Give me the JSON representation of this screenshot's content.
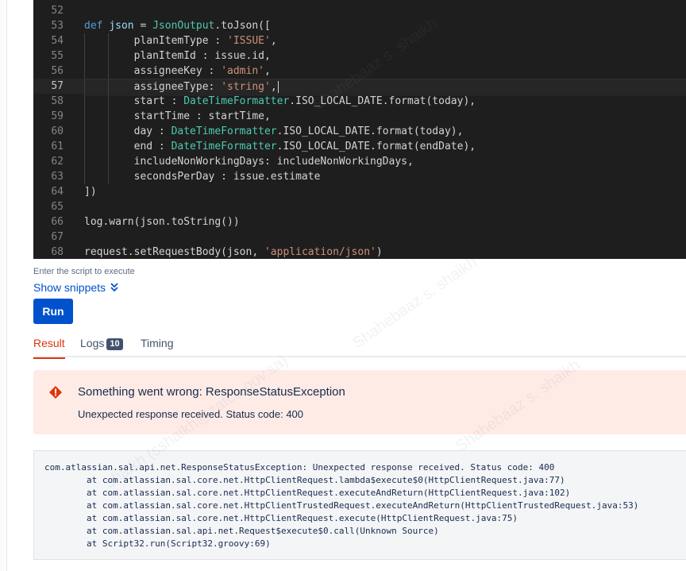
{
  "editor": {
    "lines": [
      {
        "num": "52",
        "tokens": []
      },
      {
        "num": "53",
        "tokens": [
          {
            "t": "def ",
            "c": "kw"
          },
          {
            "t": "json",
            "c": "var"
          },
          {
            "t": " = ",
            "c": "plain"
          },
          {
            "t": "JsonOutput",
            "c": "cls"
          },
          {
            "t": ".toJson([",
            "c": "plain"
          }
        ]
      },
      {
        "num": "54",
        "tokens": [
          {
            "t": "        planItemType : ",
            "c": "plain"
          },
          {
            "t": "'ISSUE'",
            "c": "str"
          },
          {
            "t": ",",
            "c": "plain"
          }
        ]
      },
      {
        "num": "55",
        "tokens": [
          {
            "t": "        planItemId : issue.id,",
            "c": "plain"
          }
        ]
      },
      {
        "num": "56",
        "tokens": [
          {
            "t": "        assigneeKey : ",
            "c": "plain"
          },
          {
            "t": "'admin'",
            "c": "str"
          },
          {
            "t": ",",
            "c": "plain"
          }
        ]
      },
      {
        "num": "57",
        "tokens": [
          {
            "t": "        assigneeType: ",
            "c": "plain"
          },
          {
            "t": "'string'",
            "c": "str"
          },
          {
            "t": ",",
            "c": "plain"
          }
        ]
      },
      {
        "num": "58",
        "tokens": [
          {
            "t": "        start : ",
            "c": "plain"
          },
          {
            "t": "DateTimeFormatter",
            "c": "cls"
          },
          {
            "t": ".ISO_LOCAL_DATE.format(today),",
            "c": "plain"
          }
        ]
      },
      {
        "num": "59",
        "tokens": [
          {
            "t": "        startTime : startTime,",
            "c": "plain"
          }
        ]
      },
      {
        "num": "60",
        "tokens": [
          {
            "t": "        day : ",
            "c": "plain"
          },
          {
            "t": "DateTimeFormatter",
            "c": "cls"
          },
          {
            "t": ".ISO_LOCAL_DATE.format(today),",
            "c": "plain"
          }
        ]
      },
      {
        "num": "61",
        "tokens": [
          {
            "t": "        end : ",
            "c": "plain"
          },
          {
            "t": "DateTimeFormatter",
            "c": "cls"
          },
          {
            "t": ".ISO_LOCAL_DATE.format(endDate),",
            "c": "plain"
          }
        ]
      },
      {
        "num": "62",
        "tokens": [
          {
            "t": "        includeNonWorkingDays: includeNonWorkingDays,",
            "c": "plain"
          }
        ]
      },
      {
        "num": "63",
        "tokens": [
          {
            "t": "        secondsPerDay : issue.estimate",
            "c": "plain"
          }
        ]
      },
      {
        "num": "64",
        "tokens": [
          {
            "t": "])",
            "c": "plain"
          }
        ]
      },
      {
        "num": "65",
        "tokens": []
      },
      {
        "num": "66",
        "tokens": [
          {
            "t": "log.warn(json.toString())",
            "c": "plain"
          }
        ]
      },
      {
        "num": "67",
        "tokens": []
      },
      {
        "num": "68",
        "tokens": [
          {
            "t": "request.setRequestBody(json, ",
            "c": "plain"
          },
          {
            "t": "'application/json'",
            "c": "str"
          },
          {
            "t": ")",
            "c": "plain"
          }
        ]
      }
    ],
    "active_line": "57"
  },
  "hint": "Enter the script to execute",
  "snippets_label": "Show snippets",
  "run_label": "Run",
  "tabs": [
    {
      "label": "Result",
      "active": true
    },
    {
      "label": "Logs",
      "badge": "10"
    },
    {
      "label": "Timing"
    }
  ],
  "error": {
    "title": "Something went wrong: ResponseStatusException",
    "message": "Unexpected response received. Status code: 400"
  },
  "trace": [
    "com.atlassian.sal.api.net.ResponseStatusException: Unexpected response received. Status code: 400",
    "at com.atlassian.sal.core.net.HttpClientRequest.lambda$execute$0(HttpClientRequest.java:77)",
    "at com.atlassian.sal.core.net.HttpClientRequest.executeAndReturn(HttpClientRequest.java:102)",
    "at com.atlassian.sal.core.net.HttpClientTrustedRequest.executeAndReturn(HttpClientTrustedRequest.java:53)",
    "at com.atlassian.sal.core.net.HttpClientRequest.execute(HttpClientRequest.java:75)",
    "at com.atlassian.sal.api.net.Request$execute$0.call(Unknown Source)",
    "at Script32.run(Script32.groovy:69)"
  ],
  "colors": {
    "accent": "#0052cc",
    "error_bg": "#ffebe6",
    "error_icon": "#de350b",
    "editor_bg": "#1e1e1e"
  }
}
